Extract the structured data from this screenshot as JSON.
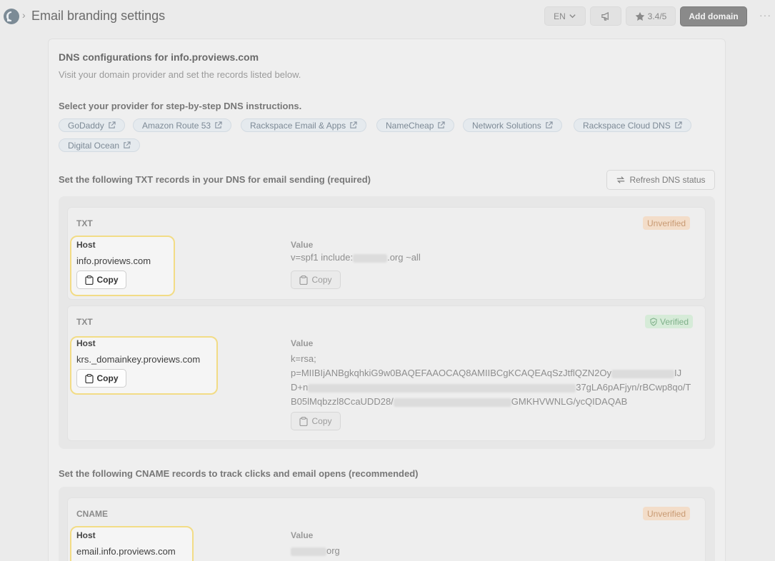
{
  "header": {
    "breadcrumb_sep": "›",
    "title": "Email branding settings",
    "lang": "EN",
    "rating": "3.4/5",
    "add_domain": "Add domain",
    "more": "···"
  },
  "dns": {
    "heading": "DNS configurations for info.proviews.com",
    "subheading": "Visit your domain provider and set the records listed below.",
    "provider_heading": "Select your provider for step-by-step DNS instructions.",
    "providers": [
      "GoDaddy",
      "Amazon Route 53",
      "Rackspace Email & Apps",
      "NameCheap",
      "Network Solutions",
      "Rackspace Cloud DNS",
      "Digital Ocean"
    ],
    "txt_heading": "Set the following TXT records in your DNS for email sending (required)",
    "refresh": "Refresh DNS status",
    "cname_heading": "Set the following CNAME records to track clicks and email opens (recommended)"
  },
  "records": {
    "host_label": "Host",
    "value_label": "Value",
    "copy": "Copy",
    "txt1": {
      "type": "TXT",
      "status": "Unverified",
      "host": "info.proviews.com",
      "value_prefix": "v=spf1 include:",
      "value_suffix": ".org ~all"
    },
    "txt2": {
      "type": "TXT",
      "status": "Verified",
      "host": "krs._domainkey.proviews.com",
      "line1": "k=rsa;",
      "line2a": "p=MIIBIjANBgkqhkiG9w0BAQEFAAOCAQ8AMIIBCgKCAQEAqSzJtflQZN2Oy",
      "line2b": "IJ",
      "line3a": "D+n",
      "line3b": "37gLA6pAFjyn/rBCwp8qo/T",
      "line4a": "B05lMqbzzl8CcaUDD28/",
      "line4b": "GMKHVWNLG/ycQIDAQAB"
    },
    "cname1": {
      "type": "CNAME",
      "status": "Unverified",
      "host": "email.info.proviews.com",
      "value_suffix": "org"
    }
  },
  "colors": {
    "highlight": "#f2dc86",
    "unverified": "#c89a73",
    "verified": "#7fb08a"
  }
}
